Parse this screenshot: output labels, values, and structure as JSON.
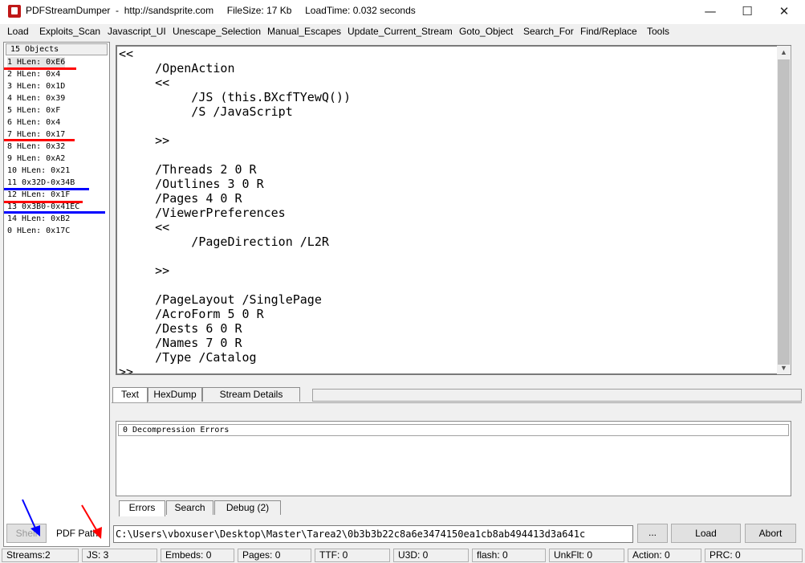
{
  "window": {
    "title": "PDFStreamDumper  -  http://sandsprite.com     FileSize: 17 Kb     LoadTime: 0.032 seconds",
    "minimize": "—",
    "maximize": "☐",
    "close": "✕"
  },
  "menu": [
    "Load",
    "Exploits_Scan",
    "Javascript_UI",
    "Unescape_Selection",
    "Manual_Escapes",
    "Update_Current_Stream",
    "Goto_Object",
    "Search_For",
    "Find/Replace",
    "Tools"
  ],
  "objects": {
    "header": "15 Objects",
    "items": [
      {
        "label": "1 HLen: 0xE6"
      },
      {
        "label": "2 HLen: 0x4"
      },
      {
        "label": "3 HLen: 0x1D"
      },
      {
        "label": "4 HLen: 0x39"
      },
      {
        "label": "5 HLen: 0xF"
      },
      {
        "label": "6 HLen: 0x4"
      },
      {
        "label": "7 HLen: 0x17"
      },
      {
        "label": "8 HLen: 0x32"
      },
      {
        "label": "9 HLen: 0xA2"
      },
      {
        "label": "10 HLen: 0x21"
      },
      {
        "label": "11 0x32D-0x34B"
      },
      {
        "label": "12 HLen: 0x1F"
      },
      {
        "label": "13 0x3B0-0x41EC"
      },
      {
        "label": "14 HLen: 0xB2"
      },
      {
        "label": "0 HLen: 0x17C"
      }
    ]
  },
  "annotation_colors": {
    "red": "#ff0000",
    "blue": "#0000ff"
  },
  "text_view": {
    "content": "<<\n     /OpenAction\n     <<\n          /JS (this.BXcfTYewQ())\n          /S /JavaScript\n\n     >>\n\n     /Threads 2 0 R\n     /Outlines 3 0 R\n     /Pages 4 0 R\n     /ViewerPreferences\n     <<\n          /PageDirection /L2R\n\n     >>\n\n     /PageLayout /SinglePage\n     /AcroForm 5 0 R\n     /Dests 6 0 R\n     /Names 7 0 R\n     /Type /Catalog\n>>"
  },
  "view_tabs": [
    "Text",
    "HexDump",
    "Stream Details"
  ],
  "errors_panel": {
    "header": "0 Decompression Errors"
  },
  "bottom_tabs": [
    "Errors",
    "Search",
    "Debug (2)"
  ],
  "bottom": {
    "shell_button": "Shell",
    "pdf_path_label": "PDF Path",
    "path_value": "C:\\Users\\vboxuser\\Desktop\\Master\\Tarea2\\0b3b3b22c8a6e3474150ea1cb8ab494413d3a641c",
    "browse_button": "...",
    "load_button": "Load",
    "abort_button": "Abort"
  },
  "status": [
    "Streams:2",
    "JS: 3",
    "Embeds: 0",
    "Pages: 0",
    "TTF: 0",
    "U3D: 0",
    "flash: 0",
    "UnkFlt: 0",
    "Action: 0",
    "PRC: 0"
  ]
}
